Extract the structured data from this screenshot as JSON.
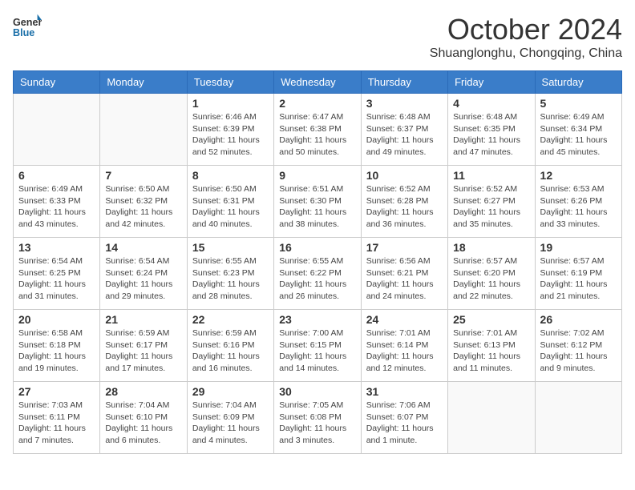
{
  "header": {
    "logo_line1": "General",
    "logo_line2": "Blue",
    "month": "October 2024",
    "location": "Shuanglonghu, Chongqing, China"
  },
  "weekdays": [
    "Sunday",
    "Monday",
    "Tuesday",
    "Wednesday",
    "Thursday",
    "Friday",
    "Saturday"
  ],
  "weeks": [
    [
      {
        "day": "",
        "info": ""
      },
      {
        "day": "",
        "info": ""
      },
      {
        "day": "1",
        "info": "Sunrise: 6:46 AM\nSunset: 6:39 PM\nDaylight: 11 hours and 52 minutes."
      },
      {
        "day": "2",
        "info": "Sunrise: 6:47 AM\nSunset: 6:38 PM\nDaylight: 11 hours and 50 minutes."
      },
      {
        "day": "3",
        "info": "Sunrise: 6:48 AM\nSunset: 6:37 PM\nDaylight: 11 hours and 49 minutes."
      },
      {
        "day": "4",
        "info": "Sunrise: 6:48 AM\nSunset: 6:35 PM\nDaylight: 11 hours and 47 minutes."
      },
      {
        "day": "5",
        "info": "Sunrise: 6:49 AM\nSunset: 6:34 PM\nDaylight: 11 hours and 45 minutes."
      }
    ],
    [
      {
        "day": "6",
        "info": "Sunrise: 6:49 AM\nSunset: 6:33 PM\nDaylight: 11 hours and 43 minutes."
      },
      {
        "day": "7",
        "info": "Sunrise: 6:50 AM\nSunset: 6:32 PM\nDaylight: 11 hours and 42 minutes."
      },
      {
        "day": "8",
        "info": "Sunrise: 6:50 AM\nSunset: 6:31 PM\nDaylight: 11 hours and 40 minutes."
      },
      {
        "day": "9",
        "info": "Sunrise: 6:51 AM\nSunset: 6:30 PM\nDaylight: 11 hours and 38 minutes."
      },
      {
        "day": "10",
        "info": "Sunrise: 6:52 AM\nSunset: 6:28 PM\nDaylight: 11 hours and 36 minutes."
      },
      {
        "day": "11",
        "info": "Sunrise: 6:52 AM\nSunset: 6:27 PM\nDaylight: 11 hours and 35 minutes."
      },
      {
        "day": "12",
        "info": "Sunrise: 6:53 AM\nSunset: 6:26 PM\nDaylight: 11 hours and 33 minutes."
      }
    ],
    [
      {
        "day": "13",
        "info": "Sunrise: 6:54 AM\nSunset: 6:25 PM\nDaylight: 11 hours and 31 minutes."
      },
      {
        "day": "14",
        "info": "Sunrise: 6:54 AM\nSunset: 6:24 PM\nDaylight: 11 hours and 29 minutes."
      },
      {
        "day": "15",
        "info": "Sunrise: 6:55 AM\nSunset: 6:23 PM\nDaylight: 11 hours and 28 minutes."
      },
      {
        "day": "16",
        "info": "Sunrise: 6:55 AM\nSunset: 6:22 PM\nDaylight: 11 hours and 26 minutes."
      },
      {
        "day": "17",
        "info": "Sunrise: 6:56 AM\nSunset: 6:21 PM\nDaylight: 11 hours and 24 minutes."
      },
      {
        "day": "18",
        "info": "Sunrise: 6:57 AM\nSunset: 6:20 PM\nDaylight: 11 hours and 22 minutes."
      },
      {
        "day": "19",
        "info": "Sunrise: 6:57 AM\nSunset: 6:19 PM\nDaylight: 11 hours and 21 minutes."
      }
    ],
    [
      {
        "day": "20",
        "info": "Sunrise: 6:58 AM\nSunset: 6:18 PM\nDaylight: 11 hours and 19 minutes."
      },
      {
        "day": "21",
        "info": "Sunrise: 6:59 AM\nSunset: 6:17 PM\nDaylight: 11 hours and 17 minutes."
      },
      {
        "day": "22",
        "info": "Sunrise: 6:59 AM\nSunset: 6:16 PM\nDaylight: 11 hours and 16 minutes."
      },
      {
        "day": "23",
        "info": "Sunrise: 7:00 AM\nSunset: 6:15 PM\nDaylight: 11 hours and 14 minutes."
      },
      {
        "day": "24",
        "info": "Sunrise: 7:01 AM\nSunset: 6:14 PM\nDaylight: 11 hours and 12 minutes."
      },
      {
        "day": "25",
        "info": "Sunrise: 7:01 AM\nSunset: 6:13 PM\nDaylight: 11 hours and 11 minutes."
      },
      {
        "day": "26",
        "info": "Sunrise: 7:02 AM\nSunset: 6:12 PM\nDaylight: 11 hours and 9 minutes."
      }
    ],
    [
      {
        "day": "27",
        "info": "Sunrise: 7:03 AM\nSunset: 6:11 PM\nDaylight: 11 hours and 7 minutes."
      },
      {
        "day": "28",
        "info": "Sunrise: 7:04 AM\nSunset: 6:10 PM\nDaylight: 11 hours and 6 minutes."
      },
      {
        "day": "29",
        "info": "Sunrise: 7:04 AM\nSunset: 6:09 PM\nDaylight: 11 hours and 4 minutes."
      },
      {
        "day": "30",
        "info": "Sunrise: 7:05 AM\nSunset: 6:08 PM\nDaylight: 11 hours and 3 minutes."
      },
      {
        "day": "31",
        "info": "Sunrise: 7:06 AM\nSunset: 6:07 PM\nDaylight: 11 hours and 1 minute."
      },
      {
        "day": "",
        "info": ""
      },
      {
        "day": "",
        "info": ""
      }
    ]
  ]
}
